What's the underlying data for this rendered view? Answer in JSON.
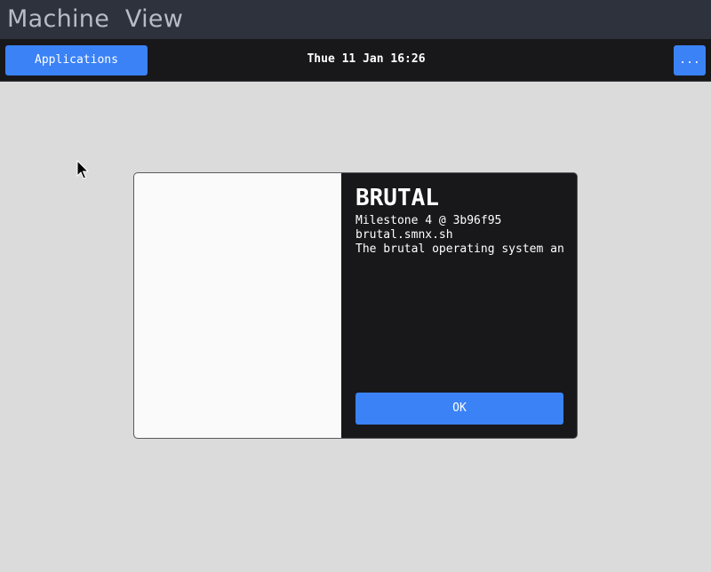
{
  "host_window": {
    "title": "Machine  View"
  },
  "panel": {
    "applications_label": "Applications",
    "clock": "Thue 11 Jan 16:26",
    "more_label": "..."
  },
  "about_dialog": {
    "app_name": "BRUTAL",
    "version": "Milestone 4 @ 3b96f95",
    "website": "brutal.smnx.sh",
    "description": "The brutal operating system and",
    "ok_label": "OK"
  },
  "colors": {
    "accent": "#3b82f6",
    "panel_bg": "#18181b",
    "desktop_bg": "#dbdbdb",
    "host_titlebar": "#2e323c"
  }
}
